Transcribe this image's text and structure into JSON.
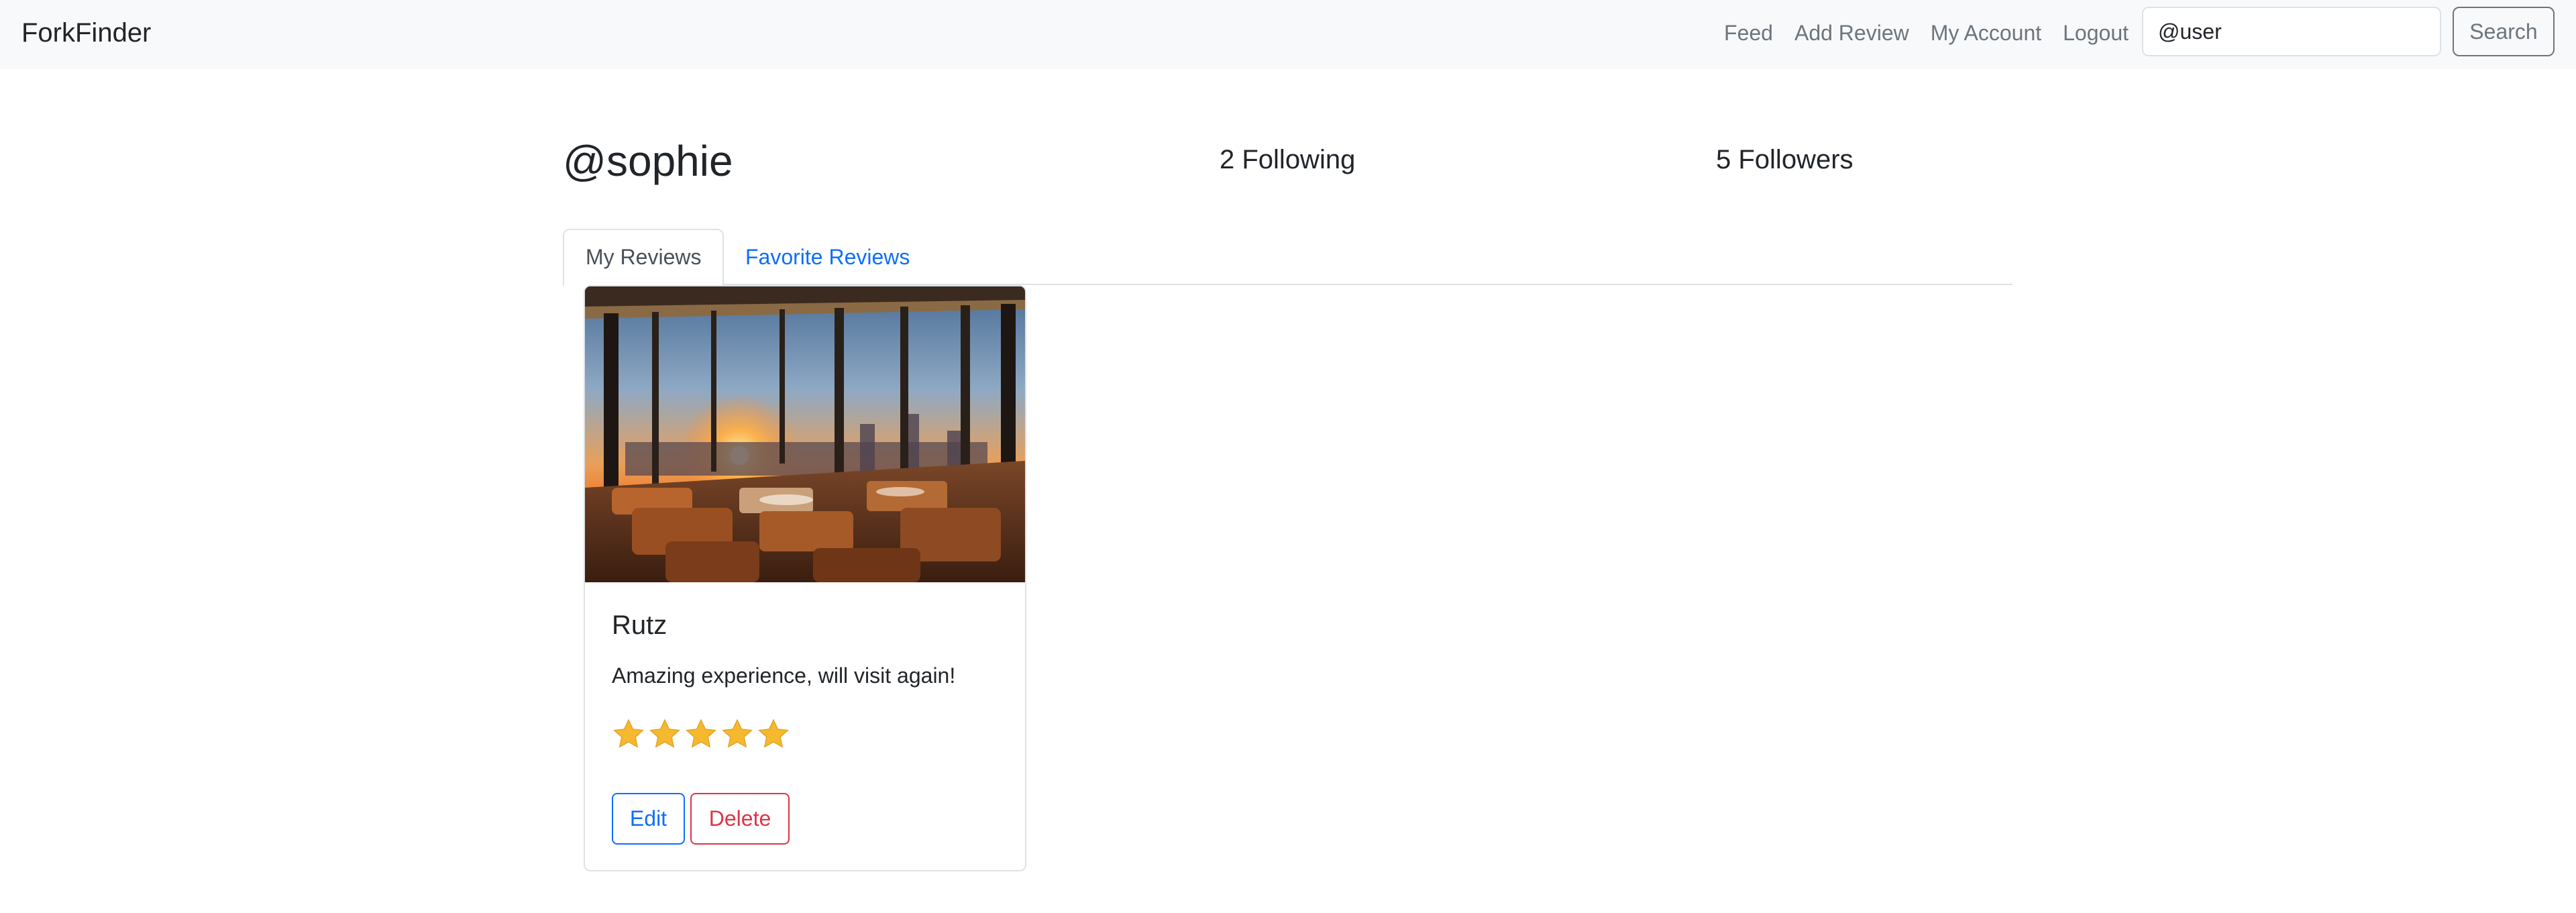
{
  "navbar": {
    "brand": "ForkFinder",
    "links": [
      "Feed",
      "Add Review",
      "My Account",
      "Logout"
    ],
    "search": {
      "value": "@user",
      "placeholder": "@user",
      "button_label": "Search"
    }
  },
  "profile": {
    "username": "@sophie",
    "following": "2 Following",
    "followers": "5 Followers"
  },
  "tabs": [
    "My Reviews",
    "Favorite Reviews"
  ],
  "active_tab": "My Reviews",
  "reviews": [
    {
      "restaurant": "Rutz",
      "text": "Amazing experience, will visit again!",
      "rating": 5,
      "rating_max": 5,
      "image": "restaurant-sunset-photo",
      "actions": {
        "edit": "Edit",
        "delete": "Delete"
      }
    }
  ],
  "colors": {
    "navbar_bg": "#f8f9fa",
    "link_blue": "#0d6efd",
    "danger_red": "#dc3545",
    "star_gold": "#f5b82e",
    "muted_text": "#6c757d"
  },
  "icons": {
    "rating": "star-icon"
  }
}
